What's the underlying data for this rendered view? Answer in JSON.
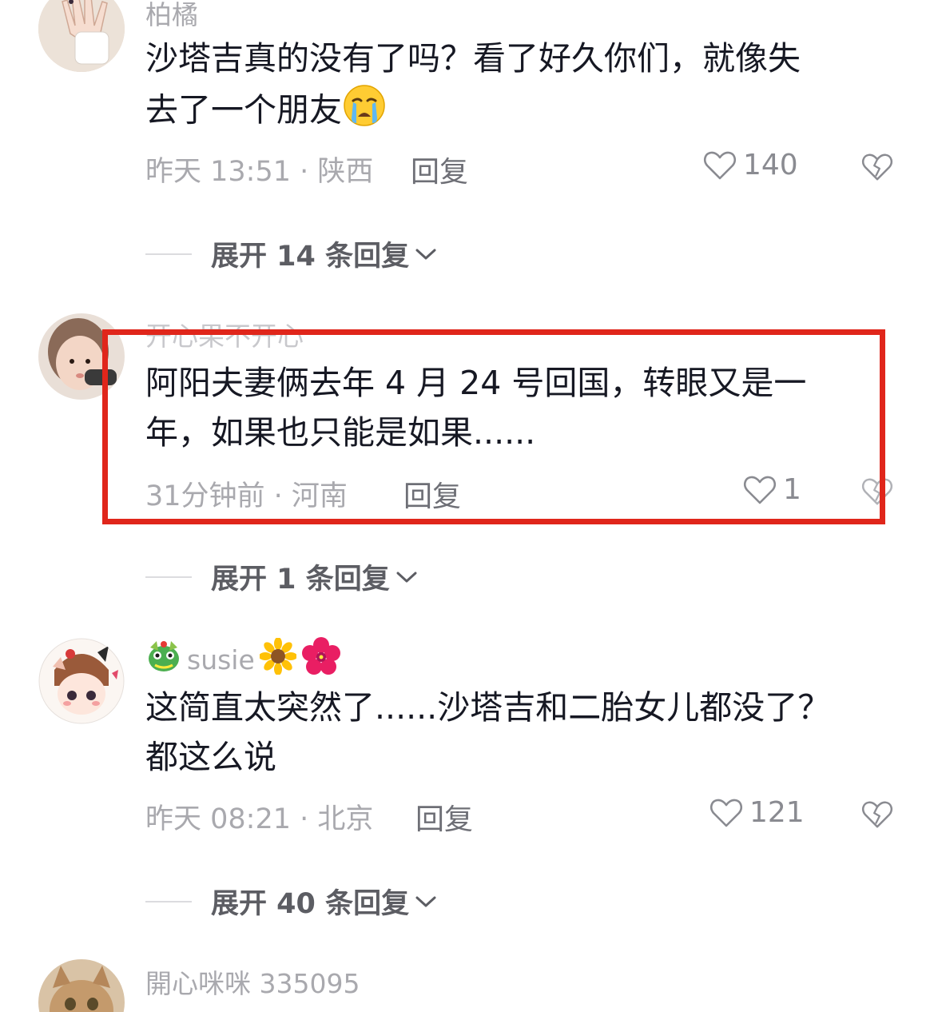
{
  "comments": [
    {
      "username": "柏橘",
      "text_line1": "沙塔吉真的没有了吗？看了好久你们，就像失",
      "text_line2": "去了一个朋友",
      "emoji": "crying-face",
      "time_location": "昨天 13:51 · 陕西",
      "reply_label": "回复",
      "likes": "140",
      "expand_label": "展开 14 条回复"
    },
    {
      "username": "开心果不开心",
      "text_line1": "阿阳夫妻俩去年 4 月 24 号回国，转眼又是一",
      "text_line2": "年，如果也只能是如果......",
      "time_location": "31分钟前 · 河南",
      "reply_label": "回复",
      "likes": "1",
      "expand_label": "展开 1 条回复"
    },
    {
      "username": "susie",
      "username_emojis": [
        "dragon-emoji",
        "sunflower-emoji",
        "hibiscus-emoji"
      ],
      "text_line1": "这简直太突然了......沙塔吉和二胎女儿都没了？",
      "text_line2": "都这么说",
      "time_location": "昨天 08:21 · 北京",
      "reply_label": "回复",
      "likes": "121",
      "expand_label": "展开 40 条回复"
    },
    {
      "username": "開心咪咪 335095"
    }
  ],
  "colors": {
    "highlight_border": "#e0261b",
    "meta_text": "#a9a9ae",
    "body_text": "#161823"
  }
}
